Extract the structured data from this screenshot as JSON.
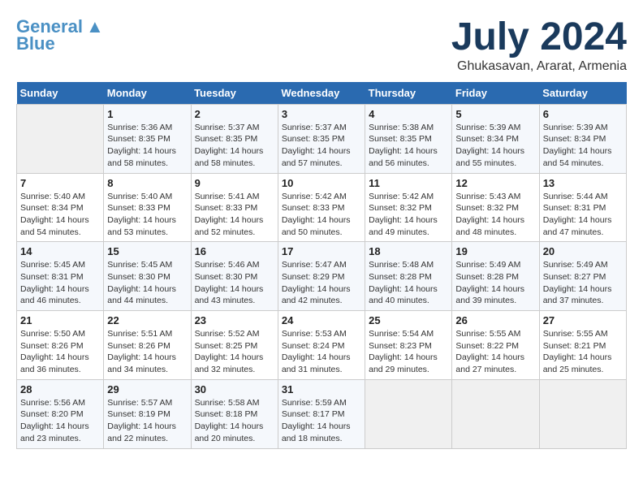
{
  "header": {
    "logo_general": "General",
    "logo_blue": "Blue",
    "month_title": "July 2024",
    "location": "Ghukasavan, Ararat, Armenia"
  },
  "days_of_week": [
    "Sunday",
    "Monday",
    "Tuesday",
    "Wednesday",
    "Thursday",
    "Friday",
    "Saturday"
  ],
  "weeks": [
    [
      {
        "day": "",
        "info": ""
      },
      {
        "day": "1",
        "info": "Sunrise: 5:36 AM\nSunset: 8:35 PM\nDaylight: 14 hours\nand 58 minutes."
      },
      {
        "day": "2",
        "info": "Sunrise: 5:37 AM\nSunset: 8:35 PM\nDaylight: 14 hours\nand 58 minutes."
      },
      {
        "day": "3",
        "info": "Sunrise: 5:37 AM\nSunset: 8:35 PM\nDaylight: 14 hours\nand 57 minutes."
      },
      {
        "day": "4",
        "info": "Sunrise: 5:38 AM\nSunset: 8:35 PM\nDaylight: 14 hours\nand 56 minutes."
      },
      {
        "day": "5",
        "info": "Sunrise: 5:39 AM\nSunset: 8:34 PM\nDaylight: 14 hours\nand 55 minutes."
      },
      {
        "day": "6",
        "info": "Sunrise: 5:39 AM\nSunset: 8:34 PM\nDaylight: 14 hours\nand 54 minutes."
      }
    ],
    [
      {
        "day": "7",
        "info": "Sunrise: 5:40 AM\nSunset: 8:34 PM\nDaylight: 14 hours\nand 54 minutes."
      },
      {
        "day": "8",
        "info": "Sunrise: 5:40 AM\nSunset: 8:33 PM\nDaylight: 14 hours\nand 53 minutes."
      },
      {
        "day": "9",
        "info": "Sunrise: 5:41 AM\nSunset: 8:33 PM\nDaylight: 14 hours\nand 52 minutes."
      },
      {
        "day": "10",
        "info": "Sunrise: 5:42 AM\nSunset: 8:33 PM\nDaylight: 14 hours\nand 50 minutes."
      },
      {
        "day": "11",
        "info": "Sunrise: 5:42 AM\nSunset: 8:32 PM\nDaylight: 14 hours\nand 49 minutes."
      },
      {
        "day": "12",
        "info": "Sunrise: 5:43 AM\nSunset: 8:32 PM\nDaylight: 14 hours\nand 48 minutes."
      },
      {
        "day": "13",
        "info": "Sunrise: 5:44 AM\nSunset: 8:31 PM\nDaylight: 14 hours\nand 47 minutes."
      }
    ],
    [
      {
        "day": "14",
        "info": "Sunrise: 5:45 AM\nSunset: 8:31 PM\nDaylight: 14 hours\nand 46 minutes."
      },
      {
        "day": "15",
        "info": "Sunrise: 5:45 AM\nSunset: 8:30 PM\nDaylight: 14 hours\nand 44 minutes."
      },
      {
        "day": "16",
        "info": "Sunrise: 5:46 AM\nSunset: 8:30 PM\nDaylight: 14 hours\nand 43 minutes."
      },
      {
        "day": "17",
        "info": "Sunrise: 5:47 AM\nSunset: 8:29 PM\nDaylight: 14 hours\nand 42 minutes."
      },
      {
        "day": "18",
        "info": "Sunrise: 5:48 AM\nSunset: 8:28 PM\nDaylight: 14 hours\nand 40 minutes."
      },
      {
        "day": "19",
        "info": "Sunrise: 5:49 AM\nSunset: 8:28 PM\nDaylight: 14 hours\nand 39 minutes."
      },
      {
        "day": "20",
        "info": "Sunrise: 5:49 AM\nSunset: 8:27 PM\nDaylight: 14 hours\nand 37 minutes."
      }
    ],
    [
      {
        "day": "21",
        "info": "Sunrise: 5:50 AM\nSunset: 8:26 PM\nDaylight: 14 hours\nand 36 minutes."
      },
      {
        "day": "22",
        "info": "Sunrise: 5:51 AM\nSunset: 8:26 PM\nDaylight: 14 hours\nand 34 minutes."
      },
      {
        "day": "23",
        "info": "Sunrise: 5:52 AM\nSunset: 8:25 PM\nDaylight: 14 hours\nand 32 minutes."
      },
      {
        "day": "24",
        "info": "Sunrise: 5:53 AM\nSunset: 8:24 PM\nDaylight: 14 hours\nand 31 minutes."
      },
      {
        "day": "25",
        "info": "Sunrise: 5:54 AM\nSunset: 8:23 PM\nDaylight: 14 hours\nand 29 minutes."
      },
      {
        "day": "26",
        "info": "Sunrise: 5:55 AM\nSunset: 8:22 PM\nDaylight: 14 hours\nand 27 minutes."
      },
      {
        "day": "27",
        "info": "Sunrise: 5:55 AM\nSunset: 8:21 PM\nDaylight: 14 hours\nand 25 minutes."
      }
    ],
    [
      {
        "day": "28",
        "info": "Sunrise: 5:56 AM\nSunset: 8:20 PM\nDaylight: 14 hours\nand 23 minutes."
      },
      {
        "day": "29",
        "info": "Sunrise: 5:57 AM\nSunset: 8:19 PM\nDaylight: 14 hours\nand 22 minutes."
      },
      {
        "day": "30",
        "info": "Sunrise: 5:58 AM\nSunset: 8:18 PM\nDaylight: 14 hours\nand 20 minutes."
      },
      {
        "day": "31",
        "info": "Sunrise: 5:59 AM\nSunset: 8:17 PM\nDaylight: 14 hours\nand 18 minutes."
      },
      {
        "day": "",
        "info": ""
      },
      {
        "day": "",
        "info": ""
      },
      {
        "day": "",
        "info": ""
      }
    ]
  ]
}
